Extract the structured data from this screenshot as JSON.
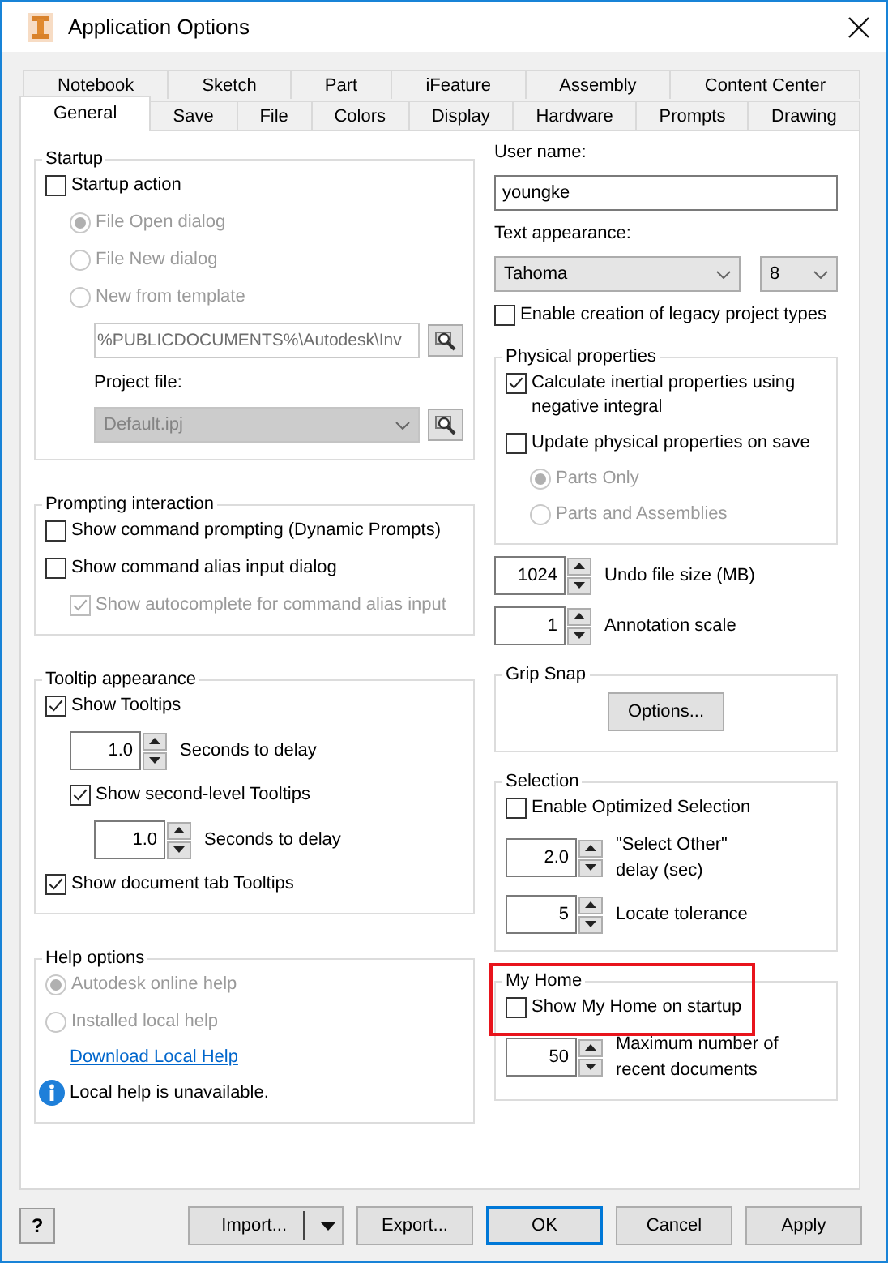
{
  "window": {
    "title": "Application Options"
  },
  "tabs": {
    "back_row": [
      {
        "label": "Notebook",
        "selected": false
      },
      {
        "label": "Sketch",
        "selected": false
      },
      {
        "label": "Part",
        "selected": false
      },
      {
        "label": "iFeature",
        "selected": false
      },
      {
        "label": "Assembly",
        "selected": false
      },
      {
        "label": "Content Center",
        "selected": false
      }
    ],
    "front_row": [
      {
        "label": "General",
        "selected": true
      },
      {
        "label": "Save",
        "selected": false
      },
      {
        "label": "File",
        "selected": false
      },
      {
        "label": "Colors",
        "selected": false
      },
      {
        "label": "Display",
        "selected": false
      },
      {
        "label": "Hardware",
        "selected": false
      },
      {
        "label": "Prompts",
        "selected": false
      },
      {
        "label": "Drawing",
        "selected": false
      }
    ]
  },
  "columns": [
    [
      {
        "kind": "group",
        "title": "Startup",
        "highlighted": false,
        "items": [
          {
            "kind": "checkbox",
            "label": "Startup action",
            "checked": false,
            "disabled": false,
            "children": [
              {
                "kind": "radio",
                "label": "File Open dialog",
                "selected": true,
                "disabled": true
              },
              {
                "kind": "radio",
                "label": "File New dialog",
                "selected": false,
                "disabled": true
              },
              {
                "kind": "radio",
                "label": "New from template",
                "selected": false,
                "disabled": true,
                "children": [
                  {
                    "kind": "field",
                    "value": "%PUBLICDOCUMENTS%\\Autodesk\\Inv",
                    "disabled": true,
                    "browse": true
                  },
                  {
                    "kind": "label",
                    "text": "Project file:"
                  },
                  {
                    "kind": "select",
                    "value": "Default.ipj",
                    "disabled": true,
                    "browse": true
                  }
                ]
              }
            ]
          }
        ]
      },
      {
        "kind": "group",
        "title": "Prompting interaction",
        "highlighted": false,
        "items": [
          {
            "kind": "checkbox",
            "label": "Show command prompting (Dynamic Prompts)",
            "checked": false,
            "disabled": false
          },
          {
            "kind": "checkbox",
            "label": "Show command alias input dialog",
            "checked": false,
            "disabled": false,
            "children": [
              {
                "kind": "checkbox",
                "label": "Show autocomplete for command alias input",
                "checked": true,
                "disabled": true
              }
            ]
          }
        ]
      },
      {
        "kind": "group",
        "title": "Tooltip appearance",
        "highlighted": false,
        "items": [
          {
            "kind": "checkbox",
            "label": "Show Tooltips",
            "checked": true,
            "disabled": false,
            "children": [
              {
                "kind": "spinner",
                "value": "1.0",
                "label": "Seconds to delay"
              },
              {
                "kind": "checkbox",
                "label": "Show second-level Tooltips",
                "checked": true,
                "disabled": false,
                "children": [
                  {
                    "kind": "spinner",
                    "value": "1.0",
                    "label": "Seconds to delay"
                  }
                ]
              }
            ]
          },
          {
            "kind": "checkbox",
            "label": "Show document tab Tooltips",
            "checked": true,
            "disabled": false
          }
        ]
      },
      {
        "kind": "group",
        "title": "Help options",
        "highlighted": false,
        "items": [
          {
            "kind": "radio",
            "label": "Autodesk online help",
            "selected": true,
            "disabled": true
          },
          {
            "kind": "radio",
            "label": "Installed local help",
            "selected": false,
            "disabled": true,
            "children": [
              {
                "kind": "link",
                "label": "Download Local Help"
              }
            ]
          },
          {
            "kind": "info",
            "text": "Local help is unavailable."
          }
        ]
      }
    ],
    [
      {
        "kind": "label",
        "text": "User name:"
      },
      {
        "kind": "field",
        "value": "youngke",
        "disabled": false,
        "browse": false
      },
      {
        "kind": "label",
        "text": "Text appearance:"
      },
      {
        "kind": "selects",
        "selects": [
          {
            "value": "Tahoma",
            "disabled": false
          },
          {
            "value": "8",
            "disabled": false
          }
        ]
      },
      {
        "kind": "checkbox",
        "label": "Enable creation of legacy project types",
        "checked": false,
        "disabled": false
      },
      {
        "kind": "group",
        "title": "Physical properties",
        "highlighted": false,
        "items": [
          {
            "kind": "checkbox",
            "label": "Calculate inertial properties using\nnegative integral",
            "checked": true,
            "disabled": false
          },
          {
            "kind": "checkbox",
            "label": "Update physical properties on save",
            "checked": false,
            "disabled": false,
            "children": [
              {
                "kind": "radio",
                "label": "Parts Only",
                "selected": true,
                "disabled": true
              },
              {
                "kind": "radio",
                "label": "Parts and Assemblies",
                "selected": false,
                "disabled": true
              }
            ]
          }
        ]
      },
      {
        "kind": "spinner",
        "value": "1024",
        "label": "Undo file size (MB)"
      },
      {
        "kind": "spinner",
        "value": "1",
        "label": "Annotation scale"
      },
      {
        "kind": "group",
        "title": "Grip Snap",
        "highlighted": false,
        "items": [
          {
            "kind": "button",
            "label": "Options..."
          }
        ]
      },
      {
        "kind": "group",
        "title": "Selection",
        "highlighted": false,
        "items": [
          {
            "kind": "checkbox",
            "label": "Enable Optimized Selection",
            "checked": false,
            "disabled": false
          },
          {
            "kind": "spinner",
            "value": "2.0",
            "label": "\"Select Other\"\ndelay (sec)"
          },
          {
            "kind": "spinner",
            "value": "5",
            "label": "Locate tolerance"
          }
        ]
      },
      {
        "kind": "group",
        "title": "My Home",
        "highlighted": true,
        "items": [
          {
            "kind": "checkbox",
            "label": "Show My Home on startup",
            "checked": false,
            "disabled": false
          },
          {
            "kind": "spinner",
            "value": "50",
            "label": "Maximum number of\nrecent documents"
          }
        ]
      }
    ]
  ],
  "footer": {
    "help_button": "?",
    "buttons": [
      {
        "label": "Import...",
        "kind": "split"
      },
      {
        "label": "Export...",
        "kind": "normal"
      },
      {
        "label": "OK",
        "kind": "default"
      },
      {
        "label": "Cancel",
        "kind": "normal"
      },
      {
        "label": "Apply",
        "kind": "normal"
      }
    ]
  }
}
